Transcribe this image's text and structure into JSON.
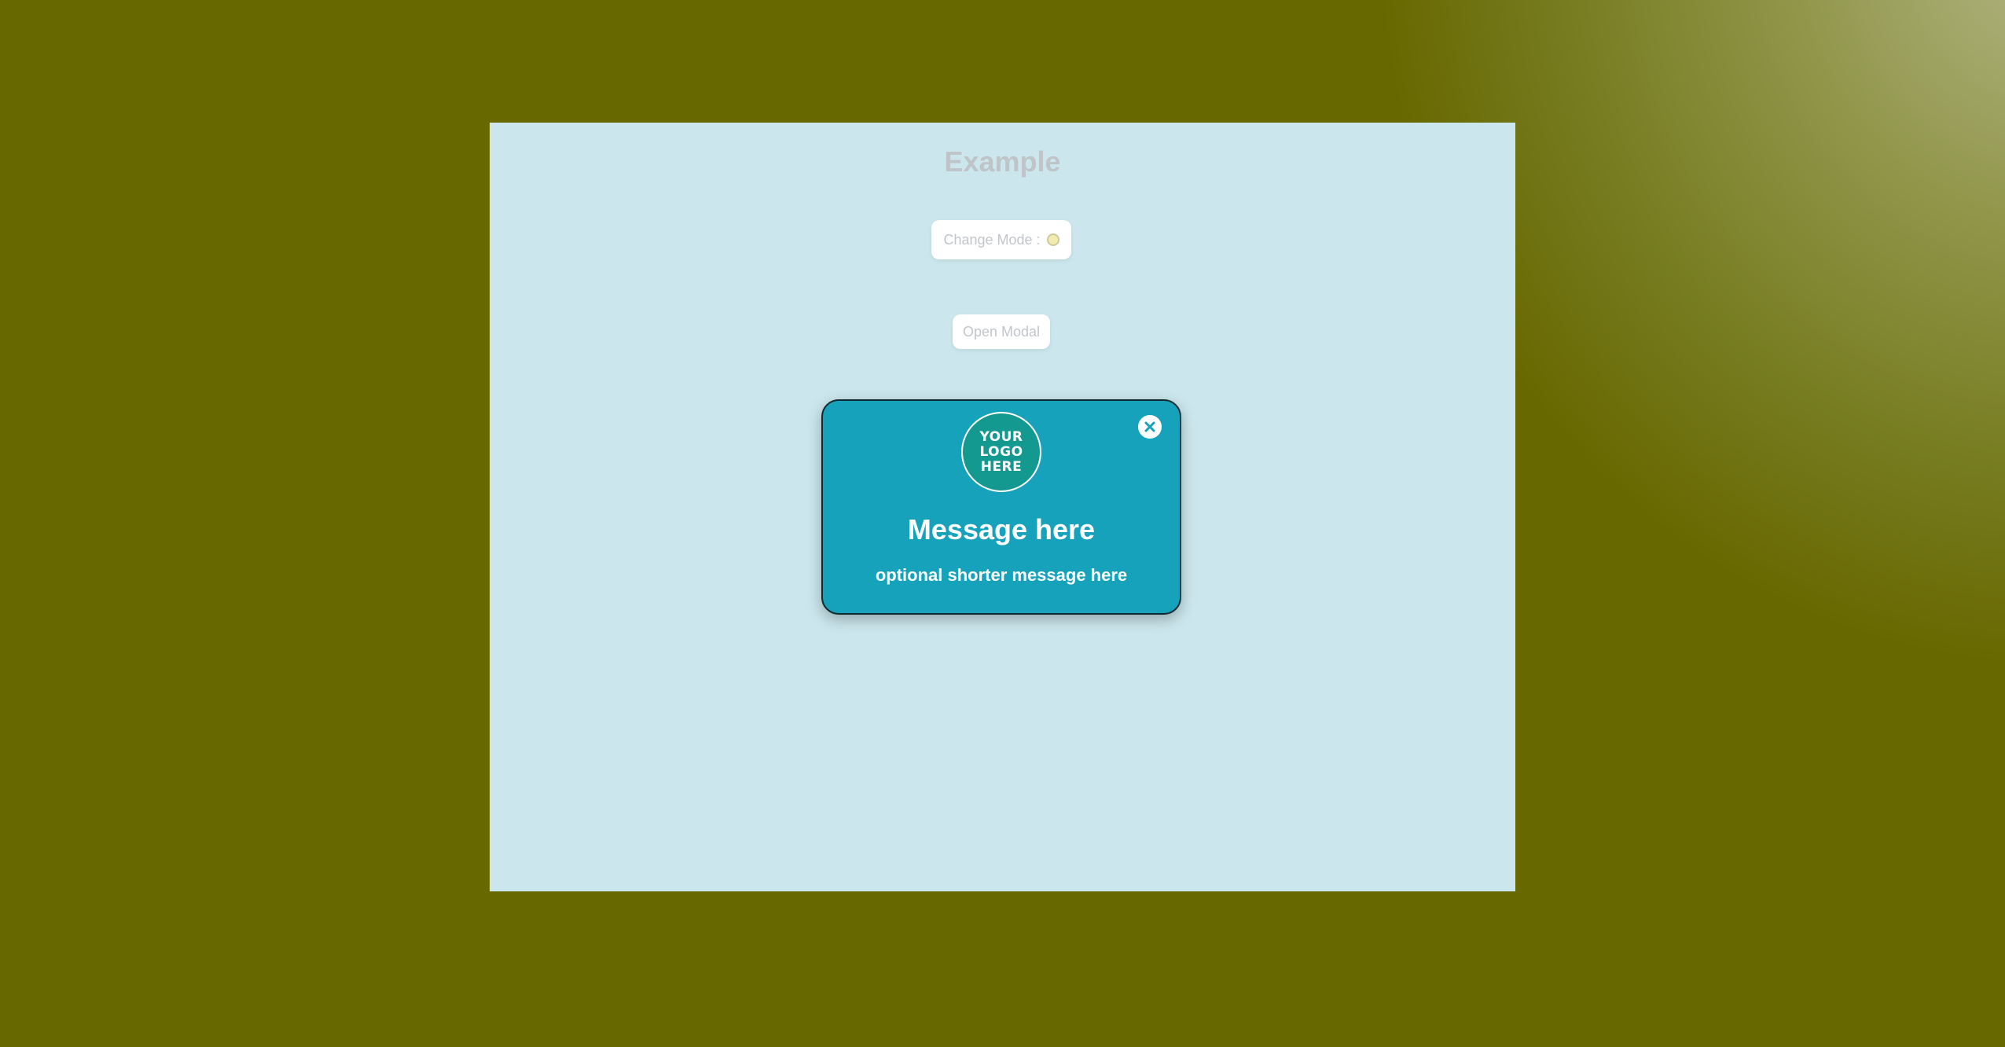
{
  "page": {
    "title": "Example",
    "mode_button_label": "Change Mode :",
    "mode_indicator_icon": "light-mode-circle",
    "open_modal_label": "Open Modal"
  },
  "modal": {
    "logo_lines": [
      "YOUR",
      "LOGO",
      "HERE"
    ],
    "title": "Message here",
    "subtitle": "optional shorter message here",
    "close_icon": "close-circle-icon"
  },
  "colors": {
    "outer_background": "#686800",
    "frame_background": "#cbe7ed",
    "modal_background": "#16a2ba",
    "logo_background": "#13998f"
  }
}
